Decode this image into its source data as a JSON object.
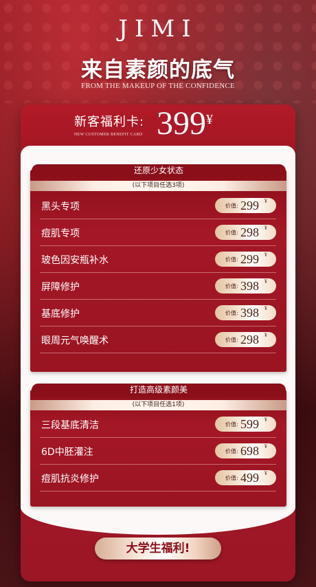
{
  "header": {
    "brand": "JIMI",
    "title": "来自素颜的底气",
    "subtitle": "FROM THE MAKEUP OF THE CONFIDENCE"
  },
  "card": {
    "label": "新客福利卡:",
    "price": "399",
    "currency": "¥",
    "subtext": "NEW CUSTOMER BENEFIT CARD"
  },
  "sections": [
    {
      "title": "还原少女状态",
      "note": "(以下项目任选3项)",
      "items": [
        {
          "name": "黑头专项",
          "price_label": "价值:",
          "price": "299",
          "currency": "¥"
        },
        {
          "name": "痘肌专项",
          "price_label": "价值:",
          "price": "298",
          "currency": "¥"
        },
        {
          "name": "玻色因安瓶补水",
          "price_label": "价值:",
          "price": "299",
          "currency": "¥"
        },
        {
          "name": "屏障修护",
          "price_label": "价值:",
          "price": "398",
          "currency": "¥"
        },
        {
          "name": "基底修护",
          "price_label": "价值:",
          "price": "398",
          "currency": "¥"
        },
        {
          "name": "眼周元气唤醒术",
          "price_label": "价值:",
          "price": "298",
          "currency": "¥"
        }
      ]
    },
    {
      "title": "打造高级素颜美",
      "note": "(以下项目任选1项)",
      "items": [
        {
          "name": "三段基底清洁",
          "price_label": "价值:",
          "price": "599",
          "currency": "¥"
        },
        {
          "name": "6D中胚灌注",
          "price_label": "价值:",
          "price": "698",
          "currency": "¥"
        },
        {
          "name": "痘肌抗炎修护",
          "price_label": "价值:",
          "price": "499",
          "currency": "¥"
        }
      ]
    }
  ],
  "footer": {
    "button_label": "大学生福利!"
  },
  "colors": {
    "primary_red": "#9f1623",
    "dark_red": "#8a0f19",
    "gold": "#e5c3a3",
    "cream": "#fbf8f7"
  }
}
